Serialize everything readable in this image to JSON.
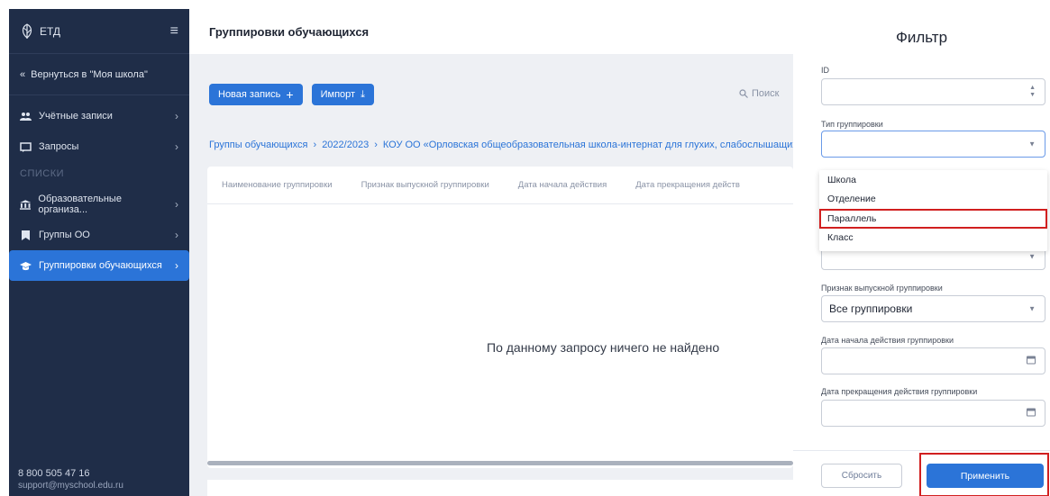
{
  "sidebar": {
    "logo_text": "ЕТД",
    "back_link": "Вернуться в \"Моя школа\"",
    "items": [
      {
        "label": "Учётные записи"
      },
      {
        "label": "Запросы"
      }
    ],
    "section_label": "СПИСКИ",
    "list_items": [
      {
        "label": "Образовательные организа..."
      },
      {
        "label": "Группы ОО"
      },
      {
        "label": "Группировки обучающихся"
      }
    ],
    "phone": "8 800 505 47 16",
    "email": "support@myschool.edu.ru"
  },
  "main": {
    "title": "Группировки обучающихся",
    "new_record_label": "Новая запись",
    "import_label": "Импорт",
    "search_placeholder": "Поиск",
    "breadcrumb": [
      "Группы обучающихся",
      "2022/2023",
      "КОУ ОО «Орловская общеобразовательная школа-интернат для глухих, слабослышащих и поздн"
    ],
    "columns": [
      "Наименование группировки",
      "Признак выпускной группировки",
      "Дата начала действия",
      "Дата прекращения действ"
    ],
    "empty_message": "По данному запросу ничего не найдено"
  },
  "filter": {
    "title": "Фильтр",
    "id_label": "ID",
    "id_value": "",
    "type_label": "Тип группировки",
    "type_value": "",
    "type_options": [
      "Школа",
      "Отделение",
      "Параллель",
      "Класс"
    ],
    "highlighted_option": "Параллель",
    "graduation_label": "Признак выпускной группировки",
    "graduation_value": "Все группировки",
    "start_date_label": "Дата начала действия группировки",
    "end_date_label": "Дата прекращения действия группировки",
    "reset_label": "Сбросить",
    "apply_label": "Применить"
  },
  "colors": {
    "sidebar_bg": "#1f2d48",
    "accent": "#2b74d8",
    "highlight": "#d11f1f"
  }
}
